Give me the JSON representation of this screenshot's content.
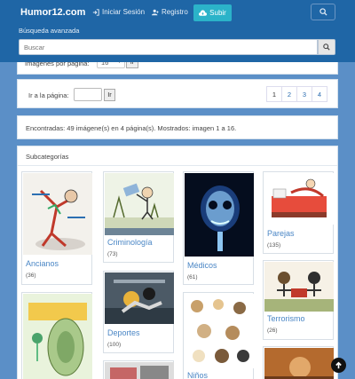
{
  "nav": {
    "brand": "Humor12.com",
    "login": "Iniciar Sesión",
    "register": "Registro",
    "upload": "Subir",
    "advanced_search": "Búsqueda avanzada",
    "search_placeholder": "Buscar"
  },
  "settings": {
    "per_page_label": "Imágenes por página:",
    "per_page_value": "16",
    "go_label": "Ir"
  },
  "pagination": {
    "goto_label": "Ir a la página:",
    "go_label": "Ir",
    "pages": [
      "1",
      "2",
      "3",
      "4"
    ],
    "current": "1"
  },
  "results": {
    "summary": "Encontradas: 49 imágene(s) en 4 página(s). Mostrados: imagen 1 a 16."
  },
  "subcategories": {
    "title": "Subcategorías",
    "items": [
      {
        "name": "Ancianos",
        "count": "(36)"
      },
      {
        "name": "Criminología",
        "count": "(73)"
      },
      {
        "name": "Médicos",
        "count": "(61)"
      },
      {
        "name": "Parejas",
        "count": "(135)"
      },
      {
        "name": "Deportes",
        "count": "(100)"
      },
      {
        "name": "Terrorismo",
        "count": "(26)"
      },
      {
        "name": "Niños",
        "count": ""
      }
    ]
  },
  "colors": {
    "navbar": "#1f66a6",
    "background": "#5b8fc7",
    "upload_button": "#2bb3c9",
    "link": "#4a86c5"
  }
}
